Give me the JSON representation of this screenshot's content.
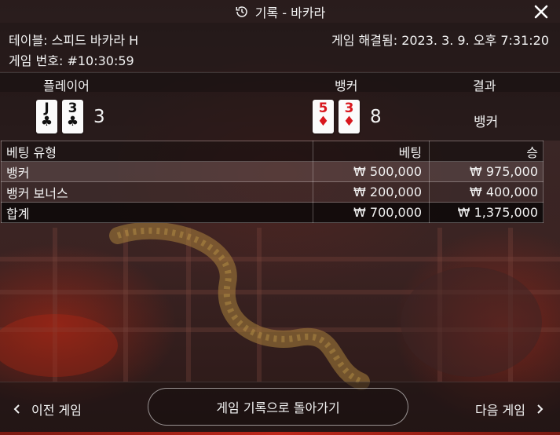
{
  "title": {
    "icon": "history-icon",
    "text": "기록 - 바카라",
    "close_icon": "close-icon"
  },
  "info": {
    "table_label": "테이블: 스피드 바카라 H",
    "resolved_label": "게임 해결됨: 2023. 3. 9. 오후 7:31:20",
    "game_number_label": "게임 번호: #10:30:59"
  },
  "cards": {
    "player_header": "플레이어",
    "banker_header": "뱅커",
    "result_header": "결과",
    "player_cards": [
      {
        "rank": "J",
        "suit": "♣",
        "color": "#111111"
      },
      {
        "rank": "3",
        "suit": "♣",
        "color": "#111111"
      }
    ],
    "player_score": "3",
    "banker_cards": [
      {
        "rank": "5",
        "suit": "♦",
        "color": "#d8161d"
      },
      {
        "rank": "3",
        "suit": "♦",
        "color": "#d8161d"
      }
    ],
    "banker_score": "8",
    "result": "뱅커"
  },
  "bets": {
    "headers": [
      "베팅 유형",
      "베팅",
      "승"
    ],
    "rows": [
      [
        "뱅커",
        "₩ 500,000",
        "₩ 975,000"
      ],
      [
        "뱅커 보너스",
        "₩ 200,000",
        "₩ 400,000"
      ],
      [
        "합계",
        "₩ 700,000",
        "₩ 1,375,000"
      ]
    ]
  },
  "footer": {
    "prev_label": "이전 게임",
    "back_label": "게임 기록으로 돌아가기",
    "next_label": "다음 게임"
  }
}
